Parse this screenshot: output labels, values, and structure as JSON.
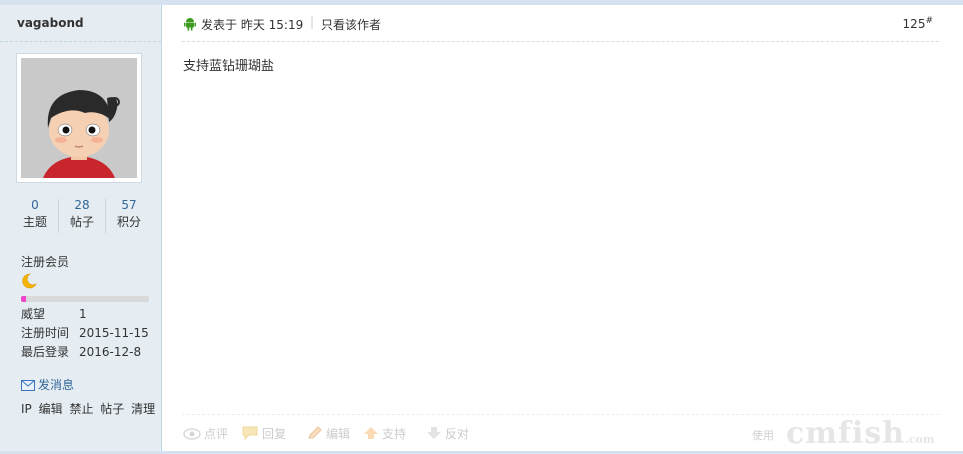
{
  "author": {
    "username": "vagabond",
    "stats": [
      {
        "value": "0",
        "label": "主题"
      },
      {
        "value": "28",
        "label": "帖子"
      },
      {
        "value": "57",
        "label": "积分"
      }
    ],
    "group": "注册会员",
    "level_progress": 0.04,
    "info": [
      {
        "key": "威望",
        "value": "1"
      },
      {
        "key": "注册时间",
        "value": "2015-11-15"
      },
      {
        "key": "最后登录",
        "value": "2016-12-8"
      }
    ],
    "send_message": "发消息",
    "admin_links": [
      "IP",
      "编辑",
      "禁止",
      "帖子",
      "清理"
    ]
  },
  "post": {
    "posted_at": "发表于 昨天 15:19",
    "only_author": "只看该作者",
    "floor": "125",
    "floor_sup": "#",
    "content": "支持蓝钻珊瑚盐"
  },
  "actions": [
    {
      "label": "点评",
      "icon": "eye-icon"
    },
    {
      "label": "回复",
      "icon": "reply-bubble-icon"
    },
    {
      "label": "编辑",
      "icon": "pencil-icon"
    },
    {
      "label": "支持",
      "icon": "arrow-up-icon"
    },
    {
      "label": "反对",
      "icon": "arrow-down-icon"
    }
  ],
  "use_label": "使用",
  "watermark": {
    "main": "cmfish",
    "suffix": ".com"
  }
}
